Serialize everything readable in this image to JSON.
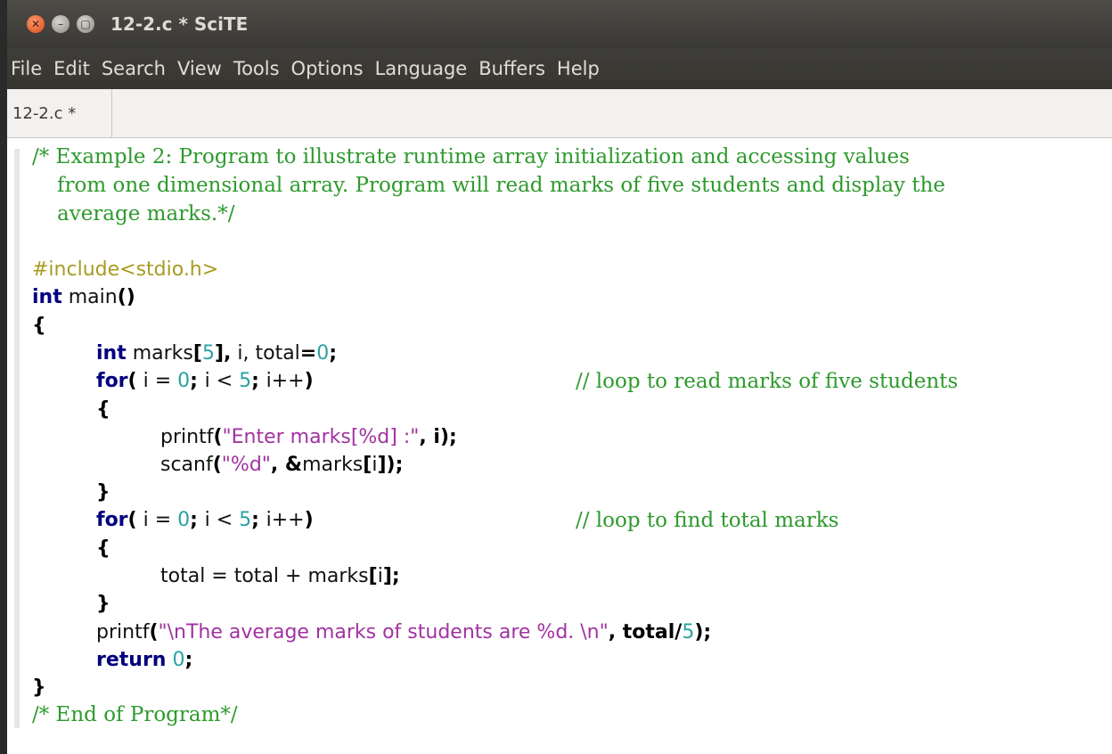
{
  "window": {
    "title": "12-2.c * SciTE",
    "buttons": {
      "close": "✕",
      "minimize": "–",
      "maximize": "▢"
    }
  },
  "menu": [
    "File",
    "Edit",
    "Search",
    "View",
    "Tools",
    "Options",
    "Language",
    "Buffers",
    "Help"
  ],
  "tabs": [
    {
      "label": "12-2.c *",
      "active": true
    }
  ],
  "editor": {
    "comment_header": [
      "/* Example 2: Program to illustrate runtime array initialization and accessing values",
      "from one dimensional array. Program will read marks of five students and display the",
      "average marks.*/"
    ],
    "include": "#include<stdio.h>",
    "tokens": {
      "int": "int",
      "main": " main",
      "paren_pair": "()",
      "lbrace": "{",
      "rbrace": "}",
      "marks": " marks",
      "lbracket": "[",
      "five": "5",
      "rbracket_comma": "],",
      "i_comma": " i,",
      "total_eq_pre": " total",
      "eq": "=",
      "zero": "0",
      "semi": ";",
      "for": "for",
      "lparen": "(",
      "i_eq": " i = ",
      "semi_space": "; ",
      "i_lt": "i < ",
      "i_pp": "i++",
      "rparen": ")",
      "printf": "printf",
      "scanf": "scanf",
      "str_enter": "\"Enter marks[%d] :\"",
      "comma_i": ", i",
      "rparen_semi": ");",
      "str_d": "\"%d\"",
      "comma_amp": ", &",
      "marks_noindent": "marks",
      "i_plain": "i",
      "rbracket_rparen_semi": "]);",
      "total_assign": "total = total + marks",
      "rbracket_semi": "];",
      "str_avg": "\"\\nThe average marks of students are %d. \\n\"",
      "comma_total_div": ", total/",
      "return": "return",
      "space_zero": " 0"
    },
    "comment_loop_read": "// loop to read marks of five students",
    "comment_loop_total": "// loop to find total marks",
    "comment_end": "/* End of Program*/"
  }
}
